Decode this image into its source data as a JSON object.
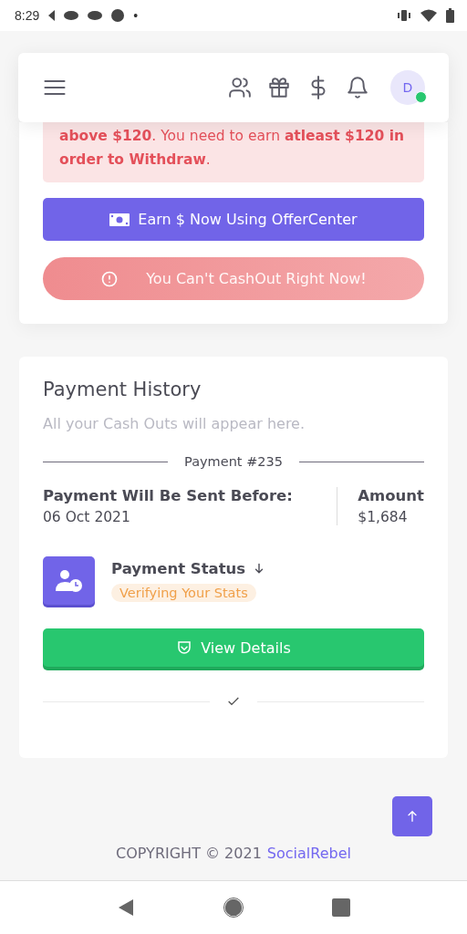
{
  "status_bar": {
    "time": "8:29",
    "notification_dot": "•"
  },
  "navbar": {
    "avatar_initial": "D",
    "online": true
  },
  "warning": {
    "text": "**above $120**. You need to earn **atleast $120 in order to Withdraw**."
  },
  "buttons": [
    {
      "label": "Earn $ Now Using OfferCenter",
      "kind": "primary"
    },
    {
      "label": "You Can't CashOut Right Now!",
      "kind": "danger"
    }
  ],
  "payment_history": {
    "title": "Payment History",
    "subtitle": "All your Cash Outs will appear here.",
    "payments": [
      {
        "number": "Payment #235",
        "date_label": "Payment Will Be Sent Before:",
        "date": "06 Oct 2021",
        "amount_label": "Amount",
        "amount": "$1,684",
        "status_label": "Payment Status",
        "status": "Verifying Your Stats",
        "details_button": "View Details"
      }
    ]
  },
  "footer": {
    "text": "COPYRIGHT © 2021",
    "brand": "SocialRebel"
  }
}
